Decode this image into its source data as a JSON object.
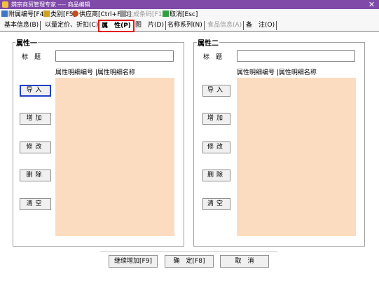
{
  "window": {
    "title": "嫦宗商贸管理专家 ---- 商品编辑",
    "close_glyph": "✕"
  },
  "toolbar": {
    "items": [
      {
        "label": "附属编号[F4]",
        "icon": "document-icon",
        "color": "#3c78c8"
      },
      {
        "label": "类别[F5]",
        "icon": "folder-icon",
        "color": "#d0a020"
      },
      {
        "label": "供应商[Ctrl+F10]",
        "icon": "supplier-icon",
        "color": "#c05020"
      },
      {
        "label": "生成条码[F12]",
        "icon": "barcode-icon",
        "color": "#9a9a9a"
      },
      {
        "label": "取消[Esc]",
        "icon": "cancel-icon",
        "color": "#30a040"
      }
    ]
  },
  "tabs": [
    {
      "label": "基本信息(B)"
    },
    {
      "label": "以量定价、折扣(C)"
    },
    {
      "label": "属　性(P)"
    },
    {
      "label": "图　片(D)"
    },
    {
      "label": "名称系列(N)"
    },
    {
      "label": "食品信息(A)"
    },
    {
      "label": "备　注(O)"
    }
  ],
  "active_tab_color": "#e01818",
  "attr1": {
    "group_title": "属性一",
    "title_label": "标　题",
    "title_value": "",
    "col1": "属性明细编号",
    "col2": "属性明细名称",
    "buttons": {
      "import": "导入",
      "add": "增加",
      "edit": "修改",
      "delete": "删除",
      "clear": "清空"
    }
  },
  "attr2": {
    "group_title": "属性二",
    "title_label": "标　题",
    "title_value": "",
    "col1": "属性明细编号",
    "col2": "属性明细名称",
    "buttons": {
      "import": "导入",
      "add": "增加",
      "edit": "修改",
      "delete": "删除",
      "clear": "清空"
    }
  },
  "list_background": "#fcdcc0",
  "footer": {
    "continue_add": "继续增加[F9]",
    "ok": "确　定[F8]",
    "cancel": "取　消"
  }
}
